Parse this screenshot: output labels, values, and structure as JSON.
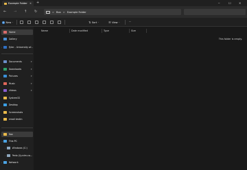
{
  "titlebar": {
    "tab_label": "Example Folder",
    "close_glyph": "✕",
    "new_tab_glyph": "+",
    "minimize_glyph": "─",
    "maximize_glyph": "☐",
    "window_close_glyph": "✕"
  },
  "nav": {
    "back_glyph": "←",
    "forward_glyph": "→",
    "up_glyph": "↑",
    "refresh_glyph": "↻"
  },
  "address": {
    "crumbs": [
      "Box",
      "Example Folder"
    ],
    "separator": ">"
  },
  "command_bar": {
    "new_label": "New",
    "sort_label": "Sort",
    "view_label": "View",
    "more_glyph": "···",
    "caret": "⌄"
  },
  "sidebar": {
    "items": [
      {
        "label": "Home",
        "icon": "home-icon",
        "color": "#d96b6b",
        "selected": true
      },
      {
        "label": "Gallery",
        "icon": "gallery-icon",
        "color": "#4a8fd8"
      },
      {
        "label": "Tyler - University of...",
        "icon": "cloud-icon",
        "color": "#2f6fc2"
      },
      {
        "label": "Documents",
        "icon": "documents-icon",
        "color": "#6c8fc9",
        "pinned": true
      },
      {
        "label": "Downloads",
        "icon": "downloads-icon",
        "color": "#2fa36b",
        "pinned": true
      },
      {
        "label": "Pictures",
        "icon": "pictures-icon",
        "color": "#3a8fd8",
        "pinned": true
      },
      {
        "label": "Music",
        "icon": "music-icon",
        "color": "#e0675a",
        "pinned": true
      },
      {
        "label": "Videos",
        "icon": "videos-icon",
        "color": "#8a5fd1",
        "pinned": true
      },
      {
        "label": "System32",
        "icon": "folder-icon",
        "color": "#e8b94a"
      },
      {
        "label": "Desktop",
        "icon": "desktop-icon",
        "color": "#3ba0e6"
      },
      {
        "label": "Screenshots",
        "icon": "folder-icon",
        "color": "#e8b94a"
      },
      {
        "label": "email testin",
        "icon": "folder-icon",
        "color": "#e8b94a"
      },
      {
        "label": "Box",
        "icon": "box-icon",
        "color": "#e8b94a",
        "selected": true
      },
      {
        "label": "This PC",
        "icon": "computer-icon",
        "color": "#4ba3e3"
      },
      {
        "label": "Windows (C:)",
        "icon": "drive-icon",
        "color": "#8fa7bd"
      },
      {
        "label": "Pedo (\\\\unim.ca...",
        "icon": "network-drive-icon",
        "color": "#8fa7bd"
      },
      {
        "label": "Network",
        "icon": "network-icon",
        "color": "#4ba3e3"
      }
    ]
  },
  "columns": [
    "Name",
    "Date modified",
    "Type",
    "Size"
  ],
  "empty_message": "This folder is empty."
}
